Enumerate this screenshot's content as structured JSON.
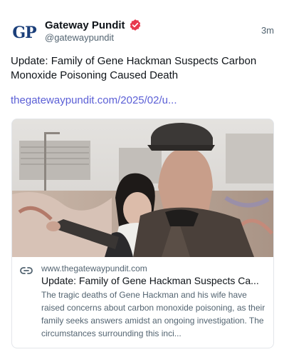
{
  "post": {
    "avatar_text": "GP",
    "display_name": "Gateway Pundit",
    "handle": "@gatewaypundit",
    "time": "3m",
    "text": "Update: Family of Gene Hackman Suspects Carbon Monoxide Poisoning Caused Death",
    "link": "thegatewaypundit.com/2025/02/u..."
  },
  "card": {
    "domain": "www.thegatewaypundit.com",
    "title": "Update: Family of Gene Hackman Suspects Ca...",
    "description": "The tragic deaths of Gene Hackman and his wife have raised concerns about carbon monoxide poisoning, as their family seeks answers amidst an ongoing investigation. The circumstances surrounding this inci..."
  },
  "colors": {
    "link": "#5b5fd6",
    "verified_badge": "#e8394d",
    "avatar_text": "#1b3f7a",
    "avatar_accent": "#e8a020"
  },
  "icons": {
    "verified": "verified-badge-icon",
    "link": "link-icon"
  }
}
